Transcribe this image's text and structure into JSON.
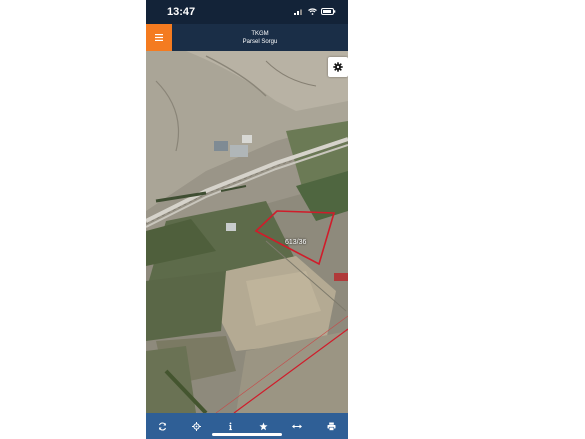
{
  "status_bar": {
    "time": "13:47"
  },
  "header": {
    "title": "TKGM",
    "subtitle": "Parsel Sorgu"
  },
  "map": {
    "parcel_label": "613/36"
  },
  "toolbar": {
    "items": [
      "refresh-icon",
      "locate-icon",
      "info-icon",
      "star-icon",
      "measure-icon",
      "print-icon"
    ]
  },
  "colors": {
    "accent": "#f47b20",
    "header_bg": "#1a2e47",
    "toolbar_bg": "#2f5f96",
    "parcel_outline": "#d01c2a"
  }
}
